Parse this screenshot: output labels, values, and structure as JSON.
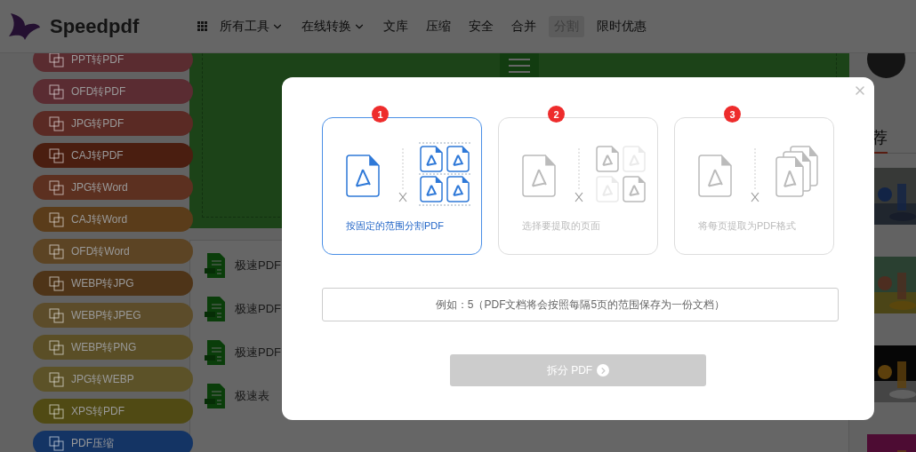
{
  "header": {
    "logo_text": "Speedpdf",
    "nav": [
      {
        "label": "所有工具",
        "dropdown": true,
        "selected": false
      },
      {
        "label": "在线转换",
        "dropdown": true,
        "selected": false
      },
      {
        "label": "文库",
        "dropdown": false,
        "selected": false
      },
      {
        "label": "压缩",
        "dropdown": false,
        "selected": false
      },
      {
        "label": "安全",
        "dropdown": false,
        "selected": false
      },
      {
        "label": "合并",
        "dropdown": false,
        "selected": false
      },
      {
        "label": "分割",
        "dropdown": false,
        "selected": true
      },
      {
        "label": "限时优惠",
        "dropdown": false,
        "selected": false
      }
    ]
  },
  "sidebar": {
    "items": [
      {
        "label": "PPT转PDF",
        "color": "#5a2c30"
      },
      {
        "label": "OFD转PDF",
        "color": "#5a2c32"
      },
      {
        "label": "JPG转PDF",
        "color": "#5a2a24"
      },
      {
        "label": "CAJ转PDF",
        "color": "#4a1e10"
      },
      {
        "label": "JPG转Word",
        "color": "#5c3020"
      },
      {
        "label": "CAJ转Word",
        "color": "#5a3c1a"
      },
      {
        "label": "OFD转Word",
        "color": "#5c4424"
      },
      {
        "label": "WEBP转JPG",
        "color": "#4e3418"
      },
      {
        "label": "WEBP转JPEG",
        "color": "#5c4c2a"
      },
      {
        "label": "WEBP转PNG",
        "color": "#5a4e26"
      },
      {
        "label": "JPG转WEBP",
        "color": "#5c5228"
      },
      {
        "label": "XPS转PDF",
        "color": "#504a14"
      },
      {
        "label": "PDF压缩",
        "color": "#143464"
      }
    ]
  },
  "files": [
    {
      "title": "极速PDF"
    },
    {
      "title": "极速PDF"
    },
    {
      "title": "极速PDF"
    },
    {
      "title": "极速表"
    }
  ],
  "recommend": {
    "heading": "荐"
  },
  "modal": {
    "options": [
      {
        "number": "1",
        "label": "按固定的范围分割PDF",
        "kind": "range",
        "selected": true
      },
      {
        "number": "2",
        "label": "选择要提取的页面",
        "kind": "select",
        "selected": false
      },
      {
        "number": "3",
        "label": "将每页提取为PDF格式",
        "kind": "each",
        "selected": false
      }
    ],
    "input": {
      "placeholder": "例如：5（PDF文档将会按照每隔5页的范围保存为一份文档）"
    },
    "button": {
      "label": "拆分 PDF",
      "disabled": true
    }
  }
}
